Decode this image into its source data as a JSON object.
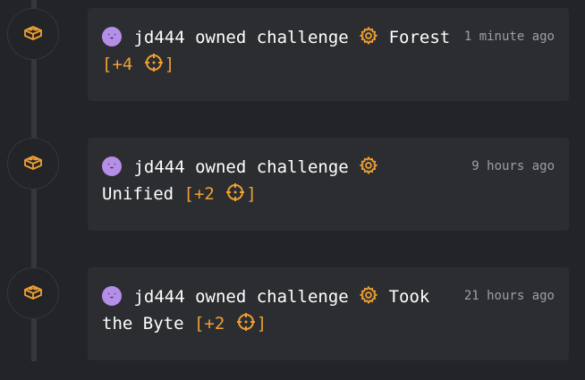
{
  "colors": {
    "accent": "#f0a030",
    "avatar": "#b58ee8",
    "card": "#2b2d31",
    "background": "#222427"
  },
  "entries": [
    {
      "icon": "lego-brick-icon",
      "user": "jd444",
      "action": "owned challenge",
      "challenge": "Forest",
      "points": "[+4",
      "points_close": "]",
      "time": "1 minute ago"
    },
    {
      "icon": "lego-brick-icon",
      "user": "jd444",
      "action": "owned challenge",
      "challenge": "Unified",
      "points": "[+2",
      "points_close": "]",
      "time": "9 hours ago"
    },
    {
      "icon": "lego-brick-icon",
      "user": "jd444",
      "action": "owned challenge",
      "challenge": "Took the Byte",
      "points": "[+2",
      "points_close": "]",
      "time": "21 hours ago"
    }
  ]
}
